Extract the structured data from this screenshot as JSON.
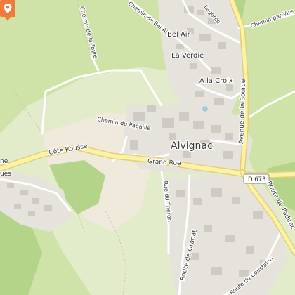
{
  "map": {
    "colors": {
      "meadow": "#cfe3a8",
      "light_meadow": "#e2eccb",
      "forest": "#b3d489",
      "built_area": "#e6e2dc",
      "building": "#cfcbc4",
      "minor_road": "#ffffff",
      "main_road": "#fbf3a3",
      "main_road_casing": "#e3cf78",
      "marker": "#f07a3a"
    },
    "labels": {
      "chemin_bel_air": "Chemin de Bel Air",
      "lagorce": "Lagorce",
      "chemin_par_vire": "Chemin par Vire",
      "chemin_toyre": "Chemin de la Toyre",
      "bel_air": "Bel Air",
      "la_verdie": "La Verdie",
      "a_la_croix": "A la Croix",
      "avenue_source": "Avenue de la Source",
      "chemin_papaille": "Chemin du Papaille",
      "alvignac": "Alvignac",
      "cote_rousse": "Côte Rousse",
      "grand_rue": "Grand Rue",
      "ne_edge": "ne",
      "ues_edge": "ues",
      "d673": "D 673",
      "route_padirac": "Route de Padirac",
      "rue_theron": "Rue du Théron",
      "route_granat": "Route de Granat",
      "route_coustalou": "Route du Coustalou"
    },
    "marker": {
      "icon": "map-pin-icon",
      "label": "location-marker"
    }
  }
}
